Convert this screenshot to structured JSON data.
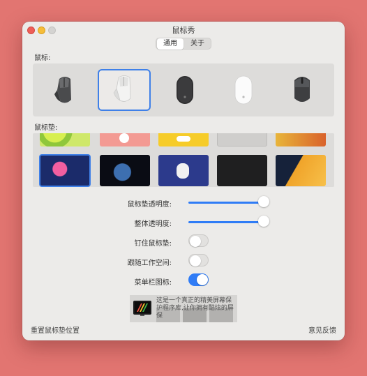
{
  "window": {
    "title": "鼠标秀"
  },
  "tabs": [
    {
      "label": "通用",
      "active": true
    },
    {
      "label": "关于",
      "active": false
    }
  ],
  "sections": {
    "mouse_label": "鼠标:",
    "pad_label": "鼠标垫:"
  },
  "mice": [
    {
      "name": "MX Master",
      "icon": "mx-master-mouse-icon",
      "selected": false
    },
    {
      "name": "MX Master white",
      "icon": "mx-master-white-mouse-icon",
      "selected": true
    },
    {
      "name": "Magic Mouse black",
      "icon": "magic-mouse-black-icon",
      "selected": false
    },
    {
      "name": "Magic Mouse white",
      "icon": "magic-mouse-white-icon",
      "selected": false
    },
    {
      "name": "MX Anywhere",
      "icon": "mx-anywhere-mouse-icon",
      "selected": false
    }
  ],
  "settings": {
    "pad_opacity_label": "鼠标垫透明度:",
    "pad_opacity_value": 1.0,
    "overall_opacity_label": "整体透明度:",
    "overall_opacity_value": 1.0,
    "pin_pad_label": "钉住鼠标垫:",
    "pin_pad_on": false,
    "follow_workspace_label": "跟随工作空间:",
    "follow_workspace_on": false,
    "menubar_icon_label": "菜单栏图标:",
    "menubar_icon_on": true
  },
  "promo": {
    "text": "这是一个真正的精美屏幕保护程序库,让你拥有酷炫的屏保"
  },
  "footer": {
    "reset_label": "重置鼠标垫位置",
    "feedback_label": "意见反馈"
  },
  "colors": {
    "accent": "#2f7cf6",
    "selection": "#3f80e8",
    "background": "#e27571"
  }
}
